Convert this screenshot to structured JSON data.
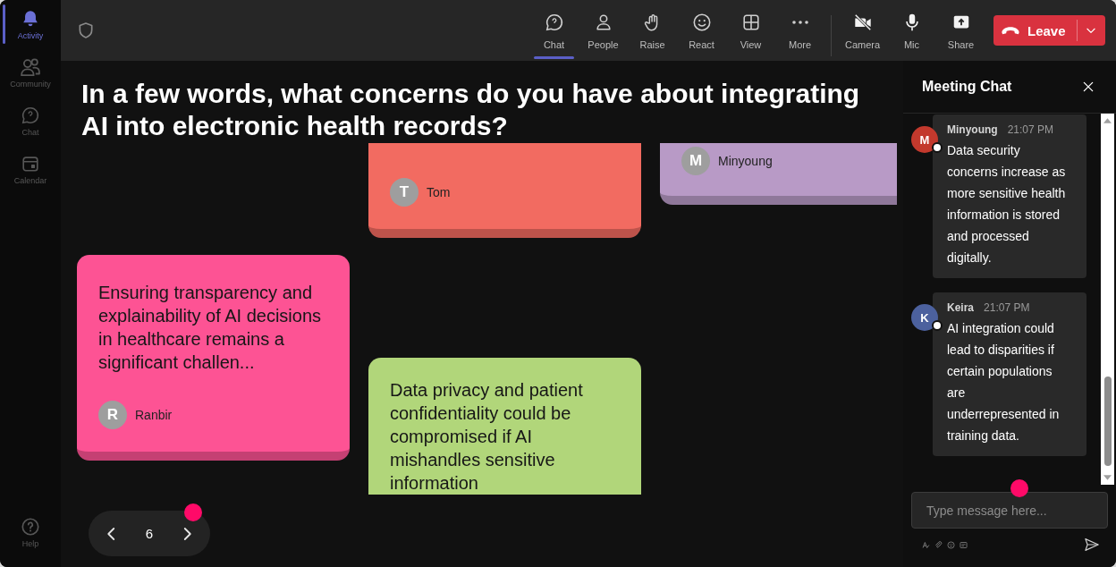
{
  "sidebar": {
    "items": [
      {
        "label": "Activity",
        "kind": "bell",
        "selected": true
      },
      {
        "label": "Community",
        "kind": "community",
        "selected": false
      },
      {
        "label": "Chat",
        "kind": "chat",
        "selected": false
      },
      {
        "label": "Calendar",
        "kind": "calendar",
        "selected": false
      }
    ],
    "help": {
      "label": "Help"
    }
  },
  "toolbar": {
    "items": [
      {
        "label": "Chat",
        "kind": "chat",
        "selected": true
      },
      {
        "label": "People",
        "kind": "people",
        "selected": false
      },
      {
        "label": "Raise",
        "kind": "hand",
        "selected": false
      },
      {
        "label": "React",
        "kind": "smile",
        "selected": false
      },
      {
        "label": "View",
        "kind": "grid",
        "selected": false
      },
      {
        "label": "More",
        "kind": "more",
        "selected": false
      }
    ],
    "devices": [
      {
        "label": "Camera",
        "kind": "camera_off"
      },
      {
        "label": "Mic",
        "kind": "mic"
      },
      {
        "label": "Share",
        "kind": "share"
      }
    ],
    "leave_button": {
      "label": "Leave"
    }
  },
  "question": {
    "title": "In a few words, what concerns do you have about integrating AI into electronic health records?"
  },
  "board": {
    "columns": [
      {
        "cards": [
          {
            "text": "Ensuring transparency and explainability of AI decisions in healthcare remains a significant challen...",
            "author": "Ranbir",
            "initial": "R",
            "color": "#fd5394"
          }
        ]
      },
      {
        "cards": [
          {
            "author": "Tom",
            "initial": "T",
            "color": "#f26b61"
          },
          {
            "text": "Data privacy and patient confidentiality could be compromised if AI mishandles sensitive information",
            "color": "#b1d67a"
          }
        ]
      },
      {
        "cards": [
          {
            "author": "Minyoung",
            "initial": "M",
            "color": "#b89ac6"
          }
        ]
      }
    ]
  },
  "pager": {
    "page": "6"
  },
  "chat": {
    "title": "Meeting Chat",
    "messages": [
      {
        "author": "Minyoung",
        "initial": "M",
        "time": "21:07 PM",
        "text": "Data security concerns increase as more sensitive health information is stored and processed digitally.",
        "color": "#c3392d"
      },
      {
        "author": "Keira",
        "initial": "K",
        "time": "21:07 PM",
        "text": "AI integration could lead to disparities if certain populations are underrepresented in training data.",
        "color": "#4c619e"
      }
    ],
    "composer": {
      "placeholder": "Type message here..."
    }
  }
}
